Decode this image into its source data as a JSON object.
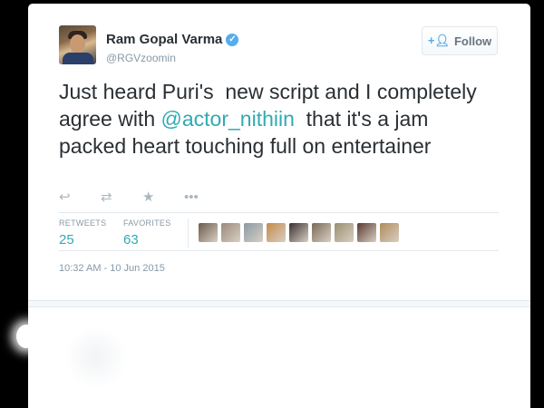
{
  "author": {
    "name": "Ram Gopal Varma",
    "handle": "@RGVzoomin",
    "verified_icon": "verified-badge-icon"
  },
  "follow_button": {
    "label": "Follow",
    "icon": "add-user-icon"
  },
  "tweet": {
    "text_before": "Just heard Puri's  new script and I completely agree with ",
    "mention": "@actor_nithiin",
    "text_after": "  that it's a jam packed heart touching full on entertainer"
  },
  "actions": [
    {
      "icon": "reply-icon",
      "glyph": "↩"
    },
    {
      "icon": "retweet-icon",
      "glyph": "⇄"
    },
    {
      "icon": "favorite-star-icon",
      "glyph": "★"
    },
    {
      "icon": "more-icon",
      "glyph": "•••"
    }
  ],
  "stats": {
    "retweets_label": "RETWEETS",
    "retweets_count": "25",
    "favorites_label": "FAVORITES",
    "favorites_count": "63"
  },
  "favoriter_avatar_colors": [
    "#6b5a4a",
    "#9a8a7a",
    "#8a9aa5",
    "#c48a4a",
    "#3a3030",
    "#7a6a55",
    "#9a8f70",
    "#5a3a30",
    "#b08a5a"
  ],
  "timestamp": "10:32 AM - 10 Jun 2015",
  "colors": {
    "link": "#31aab2",
    "accent": "#55acee",
    "text": "#292f33",
    "muted": "#8899a6"
  }
}
